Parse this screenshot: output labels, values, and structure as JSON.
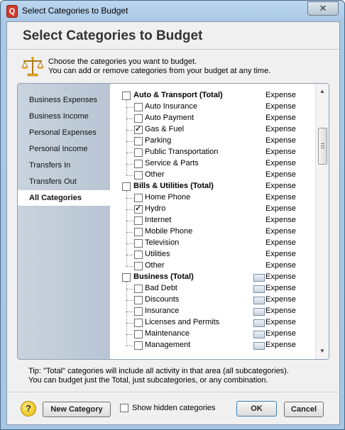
{
  "window": {
    "title": "Select Categories to Budget",
    "close_glyph": "✕",
    "app_icon_letter": "Q"
  },
  "header": {
    "title": "Select Categories to Budget",
    "intro_line1": "Choose the categories you want to budget.",
    "intro_line2": "You can add or remove categories from your budget at any time."
  },
  "nav": {
    "items": [
      {
        "label": "Business Expenses",
        "active": false
      },
      {
        "label": "Business Income",
        "active": false
      },
      {
        "label": "Personal Expenses",
        "active": false
      },
      {
        "label": "Personal Income",
        "active": false
      },
      {
        "label": "Transfers In",
        "active": false
      },
      {
        "label": "Transfers Out",
        "active": false
      },
      {
        "label": "All Categories",
        "active": true
      }
    ]
  },
  "categories": {
    "rows": [
      {
        "label": "Auto & Transport (Total)",
        "type": "Expense",
        "level": 0,
        "checked": false,
        "budget_icon": false
      },
      {
        "label": "Auto Insurance",
        "type": "Expense",
        "level": 1,
        "checked": false,
        "budget_icon": false
      },
      {
        "label": "Auto Payment",
        "type": "Expense",
        "level": 1,
        "checked": false,
        "budget_icon": false
      },
      {
        "label": "Gas & Fuel",
        "type": "Expense",
        "level": 1,
        "checked": true,
        "budget_icon": false
      },
      {
        "label": "Parking",
        "type": "Expense",
        "level": 1,
        "checked": false,
        "budget_icon": false
      },
      {
        "label": "Public Transportation",
        "type": "Expense",
        "level": 1,
        "checked": false,
        "budget_icon": false
      },
      {
        "label": "Service & Parts",
        "type": "Expense",
        "level": 1,
        "checked": false,
        "budget_icon": false
      },
      {
        "label": "Other",
        "type": "Expense",
        "level": 1,
        "checked": false,
        "budget_icon": false
      },
      {
        "label": "Bills & Utilities (Total)",
        "type": "Expense",
        "level": 0,
        "checked": false,
        "budget_icon": false
      },
      {
        "label": "Home Phone",
        "type": "Expense",
        "level": 1,
        "checked": false,
        "budget_icon": false
      },
      {
        "label": "Hydro",
        "type": "Expense",
        "level": 1,
        "checked": true,
        "budget_icon": false
      },
      {
        "label": "Internet",
        "type": "Expense",
        "level": 1,
        "checked": false,
        "budget_icon": false
      },
      {
        "label": "Mobile Phone",
        "type": "Expense",
        "level": 1,
        "checked": false,
        "budget_icon": false
      },
      {
        "label": "Television",
        "type": "Expense",
        "level": 1,
        "checked": false,
        "budget_icon": false
      },
      {
        "label": "Utilities",
        "type": "Expense",
        "level": 1,
        "checked": false,
        "budget_icon": false
      },
      {
        "label": "Other",
        "type": "Expense",
        "level": 1,
        "checked": false,
        "budget_icon": false
      },
      {
        "label": "Business (Total)",
        "type": "Expense",
        "level": 0,
        "checked": false,
        "budget_icon": true
      },
      {
        "label": "Bad Debt",
        "type": "Expense",
        "level": 1,
        "checked": false,
        "budget_icon": true
      },
      {
        "label": "Discounts",
        "type": "Expense",
        "level": 1,
        "checked": false,
        "budget_icon": true
      },
      {
        "label": "Insurance",
        "type": "Expense",
        "level": 1,
        "checked": false,
        "budget_icon": true
      },
      {
        "label": "Licenses and Permits",
        "type": "Expense",
        "level": 1,
        "checked": false,
        "budget_icon": true
      },
      {
        "label": "Maintenance",
        "type": "Expense",
        "level": 1,
        "checked": false,
        "budget_icon": true
      },
      {
        "label": "Management",
        "type": "Expense",
        "level": 1,
        "checked": false,
        "budget_icon": true
      }
    ]
  },
  "tip": {
    "line1": "Tip: \"Total\" categories will include all activity in that area (all subcategories).",
    "line2": "You can budget just the Total, just subcategories, or any combination."
  },
  "footer": {
    "help_glyph": "?",
    "new_category_label": "New Category",
    "show_hidden_label": "Show hidden categories",
    "show_hidden_checked": false,
    "ok_label": "OK",
    "cancel_label": "Cancel"
  },
  "scrollbar": {
    "up_glyph": "▲",
    "down_glyph": "▼"
  }
}
